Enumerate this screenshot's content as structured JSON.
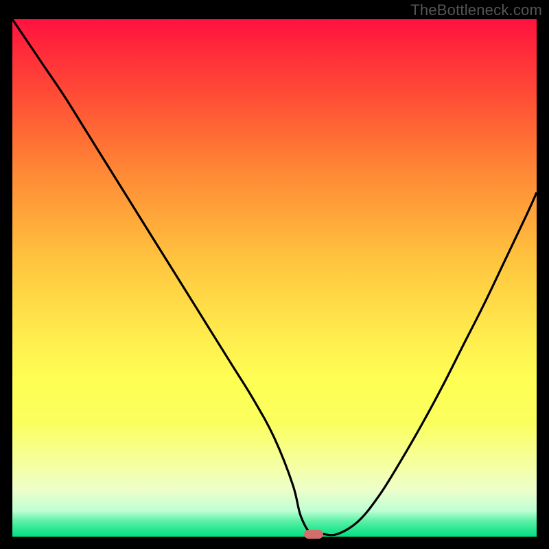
{
  "watermark": "TheBottleneck.com",
  "chart_data": {
    "type": "line",
    "title": "",
    "xlabel": "",
    "ylabel": "",
    "xlim": [
      0,
      100
    ],
    "ylim": [
      0,
      100
    ],
    "grid": false,
    "series": [
      {
        "name": "curve",
        "x": [
          0,
          3,
          6,
          10,
          14,
          18,
          22,
          26,
          30,
          34,
          38,
          42,
          46,
          50,
          53.5,
          55,
          57,
          59,
          62,
          66,
          70,
          74,
          78,
          82,
          86,
          90,
          94,
          98,
          100
        ],
        "y": [
          100,
          95.5,
          91,
          85,
          78.5,
          72,
          65.5,
          59,
          52.5,
          46,
          39.5,
          33,
          26.5,
          19,
          10,
          4,
          0.5,
          0.5,
          0.5,
          3,
          8,
          14.5,
          21.5,
          29,
          37,
          45,
          53.5,
          62,
          66.5
        ]
      }
    ],
    "marker": {
      "x": 57.5,
      "y": 0.5
    },
    "colors": {
      "curve": "#000000",
      "marker": "#d36f6a",
      "gradient_top": "#ff1240",
      "gradient_mid": "#ffee4e",
      "gradient_bottom": "#00e084",
      "frame": "#000000"
    }
  }
}
